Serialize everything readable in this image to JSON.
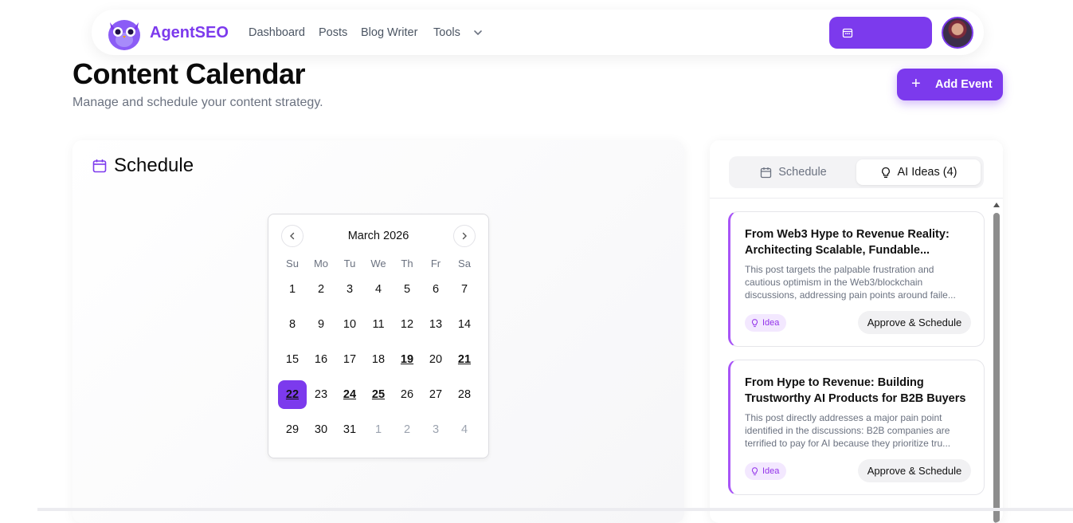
{
  "nav": {
    "brand": "AgentSEO",
    "links": [
      "Dashboard",
      "Posts",
      "Blog Writer",
      "Tools"
    ],
    "icons": {
      "logo": "owl-logo",
      "tools_dropdown": "chevron-down-icon",
      "cta": "calendar-icon",
      "avatar": "user-avatar"
    }
  },
  "header": {
    "title": "Content Calendar",
    "subtitle": "Manage and schedule your content strategy.",
    "add_button": "Add Event"
  },
  "schedule": {
    "title": "Schedule",
    "calendar": {
      "month": "March 2026",
      "weekdays": [
        "Su",
        "Mo",
        "Tu",
        "We",
        "Th",
        "Fr",
        "Sa"
      ],
      "days": [
        {
          "d": "1"
        },
        {
          "d": "2"
        },
        {
          "d": "3"
        },
        {
          "d": "4"
        },
        {
          "d": "5"
        },
        {
          "d": "6"
        },
        {
          "d": "7"
        },
        {
          "d": "8"
        },
        {
          "d": "9"
        },
        {
          "d": "10"
        },
        {
          "d": "11"
        },
        {
          "d": "12"
        },
        {
          "d": "13"
        },
        {
          "d": "14"
        },
        {
          "d": "15"
        },
        {
          "d": "16"
        },
        {
          "d": "17"
        },
        {
          "d": "18"
        },
        {
          "d": "19",
          "event": true
        },
        {
          "d": "20"
        },
        {
          "d": "21",
          "event": true
        },
        {
          "d": "22",
          "selected": true,
          "event": true
        },
        {
          "d": "23"
        },
        {
          "d": "24",
          "event": true
        },
        {
          "d": "25",
          "event": true
        },
        {
          "d": "26"
        },
        {
          "d": "27"
        },
        {
          "d": "28"
        },
        {
          "d": "29"
        },
        {
          "d": "30"
        },
        {
          "d": "31"
        },
        {
          "d": "1",
          "muted": true
        },
        {
          "d": "2",
          "muted": true
        },
        {
          "d": "3",
          "muted": true
        },
        {
          "d": "4",
          "muted": true
        }
      ]
    }
  },
  "side_panel": {
    "tabs": [
      {
        "label": "Schedule",
        "icon": "calendar-icon",
        "active": false
      },
      {
        "label": "AI Ideas (4)",
        "icon": "lightbulb-icon",
        "active": true
      }
    ],
    "ideas": [
      {
        "title": "From Web3 Hype to Revenue Reality: Architecting Scalable, Fundable...",
        "description": "This post targets the palpable frustration and cautious optimism in the Web3/blockchain discussions, addressing pain points around faile...",
        "badge": "Idea",
        "action": "Approve & Schedule"
      },
      {
        "title": "From Hype to Revenue: Building Trustworthy AI Products for B2B Buyers",
        "description": "This post directly addresses a major pain point identified in the discussions: B2B companies are terrified to pay for AI because they prioritize tru...",
        "badge": "Idea",
        "action": "Approve & Schedule"
      }
    ]
  },
  "colors": {
    "accent": "#7c3aed",
    "idea_border": "#a855f7",
    "badge_bg": "#f3e8ff"
  }
}
